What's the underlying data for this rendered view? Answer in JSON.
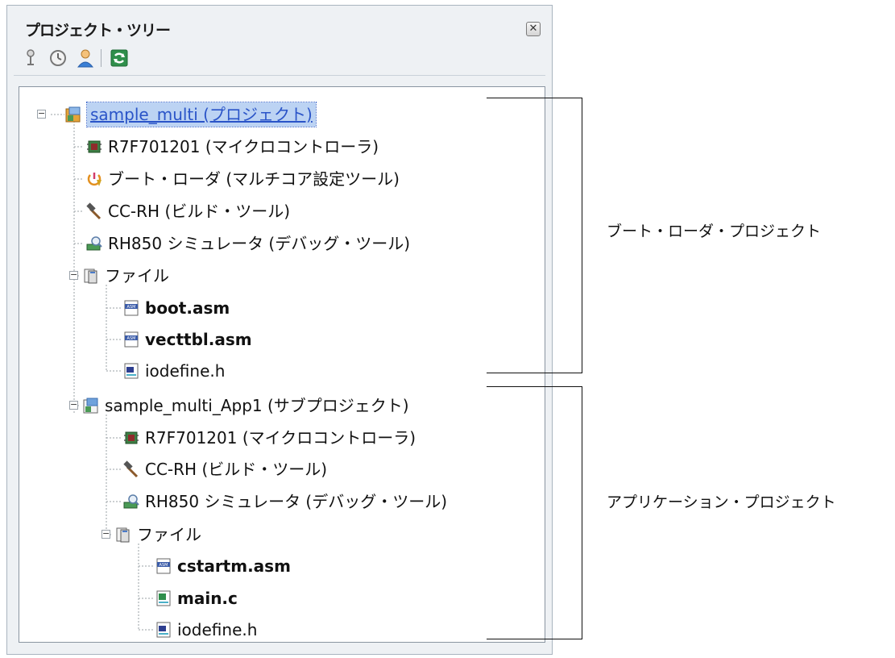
{
  "panel": {
    "title": "プロジェクト・ツリー",
    "close_glyph": "✕",
    "toolbar": [
      "pin-icon",
      "property-icon",
      "member-icon",
      "refresh-icon"
    ]
  },
  "tree": {
    "root": {
      "label": "sample_multi (プロジェクト)",
      "expanded": true,
      "selected": true
    },
    "boot": {
      "microcontroller": "R7F701201 (マイクロコントローラ)",
      "bootloader": "ブート・ローダ (マルチコア設定ツール)",
      "build_tool": "CC-RH (ビルド・ツール)",
      "debug_tool": "RH850 シミュレータ (デバッグ・ツール)",
      "files_folder": "ファイル",
      "files": [
        "boot.asm",
        "vecttbl.asm",
        "iodefine.h"
      ]
    },
    "subproject": {
      "label": "sample_multi_App1 (サブプロジェクト)",
      "microcontroller": "R7F701201 (マイクロコントローラ)",
      "build_tool": "CC-RH (ビルド・ツール)",
      "debug_tool": "RH850 シミュレータ (デバッグ・ツール)",
      "files_folder": "ファイル",
      "files": [
        "cstartm.asm",
        "main.c",
        "iodefine.h"
      ]
    }
  },
  "annotations": {
    "boot_loader_project": "ブート・ローダ・プロジェクト",
    "application_project": "アプリケーション・プロジェクト"
  }
}
